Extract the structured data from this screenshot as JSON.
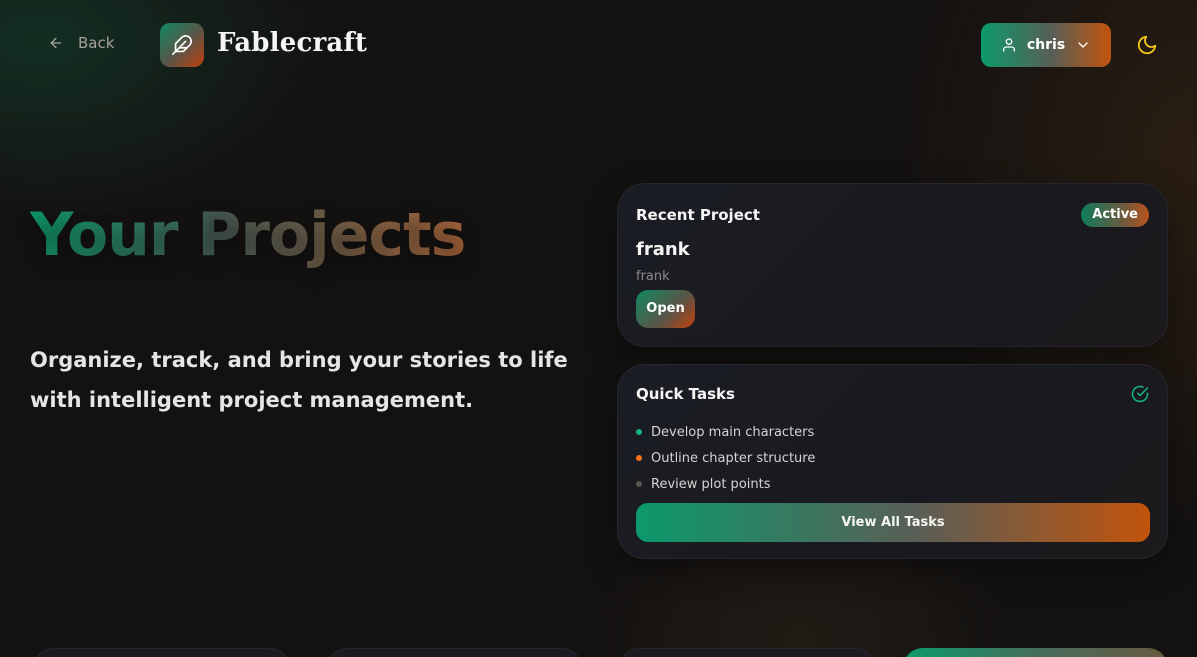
{
  "nav": {
    "back_label": "Back",
    "brand": "Fablecraft",
    "user_name": "chris"
  },
  "hero": {
    "title": "Your Projects",
    "subtitle": "Organize, track, and bring your stories to life with intelligent project management."
  },
  "recent_project": {
    "heading": "Recent Project",
    "status": "Active",
    "name": "frank",
    "description": "frank",
    "open_label": "Open"
  },
  "quick_tasks": {
    "heading": "Quick Tasks",
    "items": [
      {
        "label": "Develop main characters",
        "color": "#10b981"
      },
      {
        "label": "Outline chapter structure",
        "color": "#f97316"
      },
      {
        "label": "Review plot points",
        "color": "#57534e"
      }
    ],
    "view_all_label": "View All Tasks"
  },
  "colors": {
    "accent_green": "#0c9a6c",
    "accent_orange": "#c2540c",
    "background": "#141211",
    "moon": "#f5c518"
  }
}
